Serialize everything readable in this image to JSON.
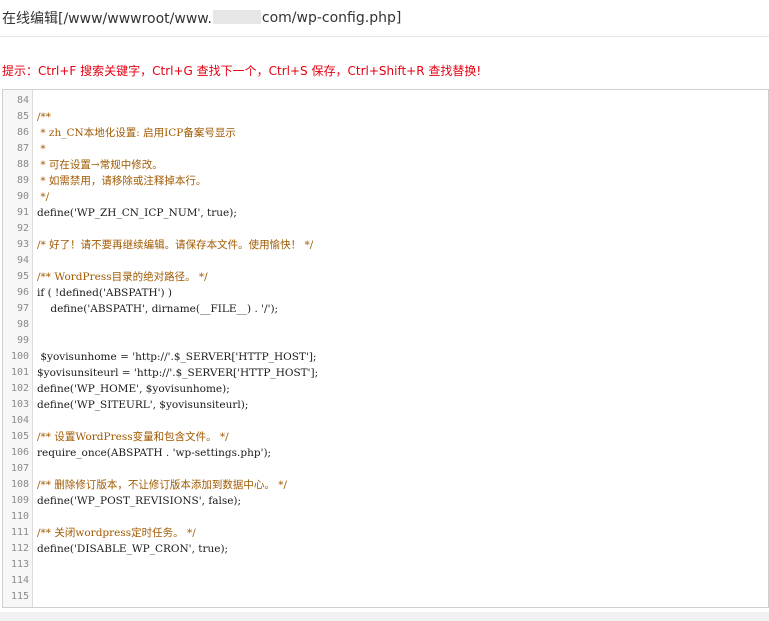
{
  "header": {
    "title_prefix": "在线编辑[/www/wwwroot/www.",
    "title_suffix": "com/wp-config.php]"
  },
  "hint": "提示：Ctrl+F 搜索关键字，Ctrl+G 查找下一个，Ctrl+S 保存，Ctrl+Shift+R 查找替换!",
  "editor": {
    "lines": [
      {
        "n": "84",
        "text": "",
        "kind": "normal"
      },
      {
        "n": "85",
        "text": "/**",
        "kind": "comment"
      },
      {
        "n": "86",
        "text": " * zh_CN本地化设置: 启用ICP备案号显示",
        "kind": "comment"
      },
      {
        "n": "87",
        "text": " *",
        "kind": "comment"
      },
      {
        "n": "88",
        "text": " * 可在设置→常规中修改。",
        "kind": "comment"
      },
      {
        "n": "89",
        "text": " * 如需禁用，请移除或注释掉本行。",
        "kind": "comment"
      },
      {
        "n": "90",
        "text": " */",
        "kind": "comment"
      },
      {
        "n": "91",
        "text": "define('WP_ZH_CN_ICP_NUM', true);",
        "kind": "normal"
      },
      {
        "n": "92",
        "text": "",
        "kind": "normal"
      },
      {
        "n": "93",
        "text": "/* 好了！请不要再继续编辑。请保存本文件。使用愉快！ */",
        "kind": "comment"
      },
      {
        "n": "94",
        "text": "",
        "kind": "normal"
      },
      {
        "n": "95",
        "text": "/** WordPress目录的绝对路径。 */",
        "kind": "comment"
      },
      {
        "n": "96",
        "text": "if ( !defined('ABSPATH') )",
        "kind": "normal"
      },
      {
        "n": "97",
        "text": "    define('ABSPATH', dirname(__FILE__) . '/');",
        "kind": "normal"
      },
      {
        "n": "98",
        "text": "",
        "kind": "normal"
      },
      {
        "n": "99",
        "text": "",
        "kind": "normal"
      },
      {
        "n": "100",
        "text": " $yovisunhome = 'http://'.$_SERVER['HTTP_HOST'];",
        "kind": "normal"
      },
      {
        "n": "101",
        "text": "$yovisunsiteurl = 'http://'.$_SERVER['HTTP_HOST'];",
        "kind": "normal"
      },
      {
        "n": "102",
        "text": "define('WP_HOME', $yovisunhome);",
        "kind": "normal"
      },
      {
        "n": "103",
        "text": "define('WP_SITEURL', $yovisunsiteurl);",
        "kind": "normal"
      },
      {
        "n": "104",
        "text": "",
        "kind": "normal"
      },
      {
        "n": "105",
        "text": "/** 设置WordPress变量和包含文件。 */",
        "kind": "comment"
      },
      {
        "n": "106",
        "text": "require_once(ABSPATH . 'wp-settings.php');",
        "kind": "normal"
      },
      {
        "n": "107",
        "text": "",
        "kind": "normal"
      },
      {
        "n": "108",
        "text": "/** 删除修订版本，不让修订版本添加到数据中心。 */",
        "kind": "comment"
      },
      {
        "n": "109",
        "text": "define('WP_POST_REVISIONS', false);",
        "kind": "normal"
      },
      {
        "n": "110",
        "text": "",
        "kind": "normal"
      },
      {
        "n": "111",
        "text": "/** 关闭wordpress定时任务。 */",
        "kind": "comment"
      },
      {
        "n": "112",
        "text": "define('DISABLE_WP_CRON', true);",
        "kind": "normal"
      },
      {
        "n": "113",
        "text": "",
        "kind": "normal"
      },
      {
        "n": "114",
        "text": "",
        "kind": "normal"
      },
      {
        "n": "115",
        "text": "",
        "kind": "normal"
      }
    ]
  }
}
